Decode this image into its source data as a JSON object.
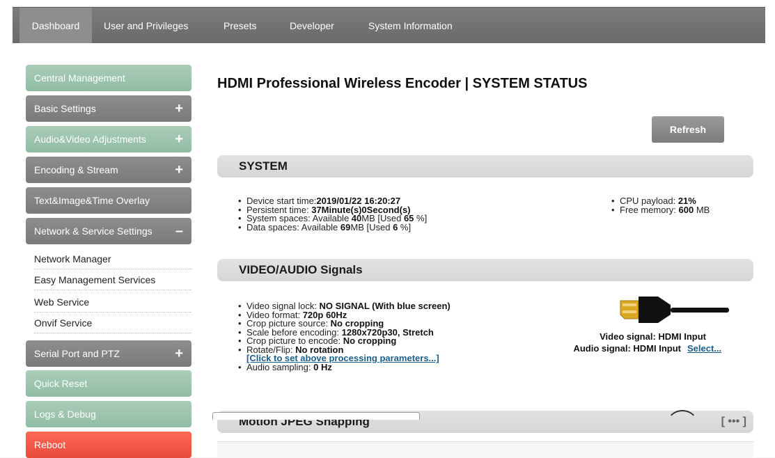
{
  "nav": {
    "tabs": [
      {
        "label": "Dashboard",
        "active": true
      },
      {
        "label": "User and Privileges"
      },
      {
        "label": "Presets"
      },
      {
        "label": "Developer"
      },
      {
        "label": "System Information"
      }
    ]
  },
  "sidebar": {
    "central_management": "Central Management",
    "basic_settings": "Basic Settings",
    "audio_video": "Audio&Video Adjustments",
    "encoding_stream": "Encoding & Stream",
    "text_overlay": "Text&Image&Time Overlay",
    "network_service": "Network & Service Settings",
    "network_sub": [
      "Network Manager",
      "Easy Management Services",
      "Web Service",
      "Onvif Service"
    ],
    "serial_ptz": "Serial Port and PTZ",
    "quick_reset": "Quick Reset",
    "logs_debug": "Logs & Debug",
    "reboot": "Reboot",
    "plus_glyph": "+",
    "minus_glyph": "–"
  },
  "main": {
    "title": "HDMI Professional Wireless Encoder | SYSTEM STATUS",
    "refresh_label": "Refresh",
    "system": {
      "heading": "SYSTEM",
      "device_start_label": "Device start time:",
      "device_start_value": "2019/01/22 16:20:27",
      "persistent_label": "Persistent time: ",
      "persistent_value": "37Minute(s)0Second(s)",
      "system_spaces_label": "System spaces: Available ",
      "system_spaces_avail": "40",
      "system_spaces_mid": "MB [Used ",
      "system_spaces_used": "65",
      "system_spaces_end": " %]",
      "data_spaces_label": "Data spaces: Available ",
      "data_spaces_avail": "69",
      "data_spaces_mid": "MB [Used ",
      "data_spaces_used": "6",
      "data_spaces_end": " %]",
      "cpu_label": "CPU payload: ",
      "cpu_value": "21%",
      "mem_label": "Free memory: ",
      "mem_value": "600",
      "mem_unit": " MB"
    },
    "video": {
      "heading": "VIDEO/AUDIO Signals",
      "lock_label": "Video signal lock: ",
      "lock_value": "NO SIGNAL (With blue screen)",
      "format_label": "Video format: ",
      "format_value": "720p 60Hz",
      "crop_src_label": "Crop picture source: ",
      "crop_src_value": "No cropping",
      "scale_label": "Scale before encoding: ",
      "scale_value": "1280x720p30, Stretch",
      "crop_enc_label": "Crop picture to encode: ",
      "crop_enc_value": "No cropping",
      "rotate_label": "Rotate/Flip: ",
      "rotate_value": "No rotation",
      "set_link": "[Click to set above processing parameters...]",
      "audio_label": "Audio sampling: ",
      "audio_value": "0 Hz",
      "video_signal": "Video signal: HDMI Input",
      "audio_signal": "Audio signal: HDMI Input",
      "select_link": "Select..."
    },
    "mjpeg": {
      "heading": "Motion JPEG Snapping",
      "more_label": "[ ••• ]"
    }
  }
}
